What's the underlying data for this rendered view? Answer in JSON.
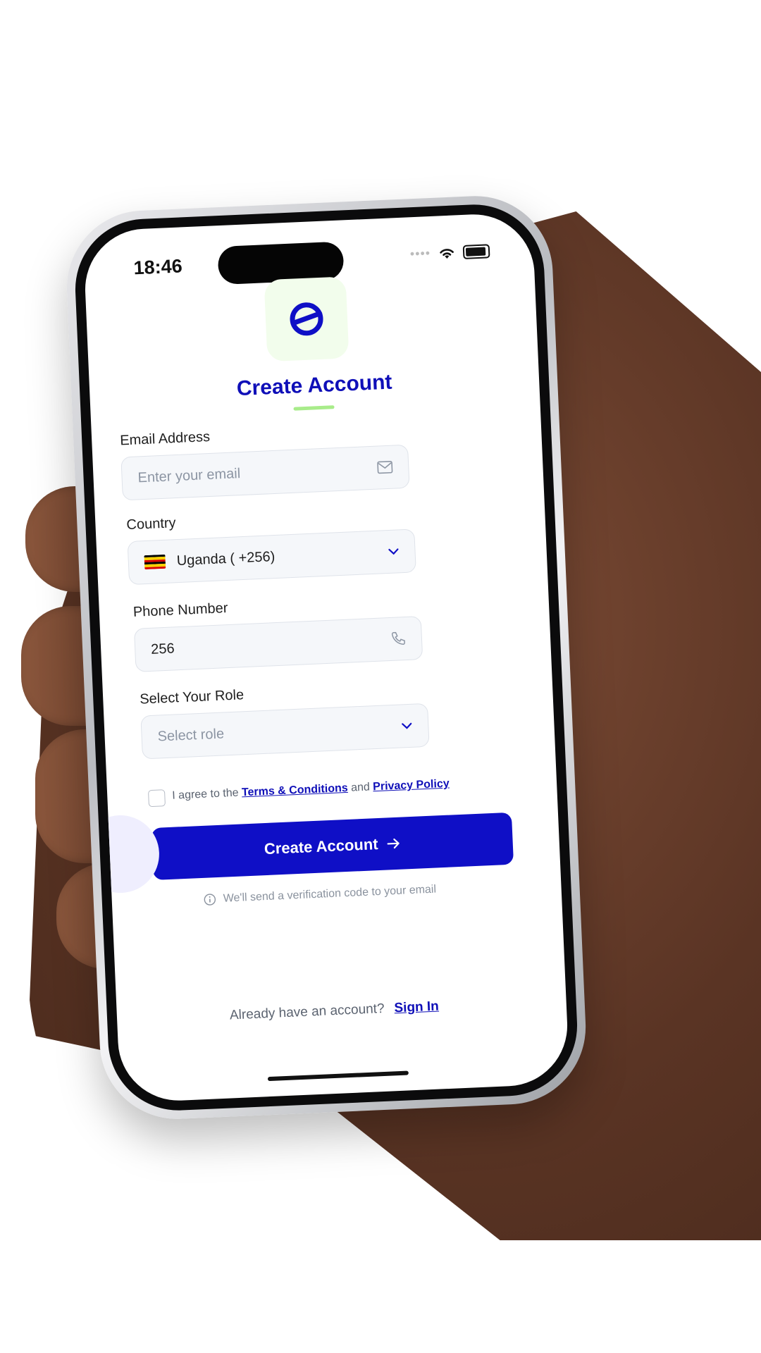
{
  "status_bar": {
    "time": "18:46"
  },
  "app": {
    "logo_glyph": "e",
    "title": "Create Account"
  },
  "form": {
    "email": {
      "label": "Email Address",
      "placeholder": "Enter your email",
      "icon": "mail-icon"
    },
    "country": {
      "label": "Country",
      "value": "Uganda ( +256)",
      "flag_colors": [
        "#000000",
        "#f8d000",
        "#d90000"
      ],
      "icon": "chevron-down-icon"
    },
    "phone": {
      "label": "Phone Number",
      "value": "256",
      "icon": "phone-icon"
    },
    "role": {
      "label": "Select Your Role",
      "placeholder": "Select role",
      "icon": "chevron-down-icon"
    },
    "agree": {
      "prefix": "I agree to the ",
      "terms": "Terms & Conditions",
      "middle": " and ",
      "privacy": "Privacy Policy",
      "checked": false
    },
    "submit_label": "Create Account",
    "info_text": "We'll send a verification code to your email"
  },
  "footer": {
    "prompt": "Already have an account?",
    "signin_label": "Sign In"
  },
  "colors": {
    "brand_blue": "#0f0fc6",
    "accent_green": "#a8ec8a",
    "logo_bg": "#f2fdec"
  }
}
